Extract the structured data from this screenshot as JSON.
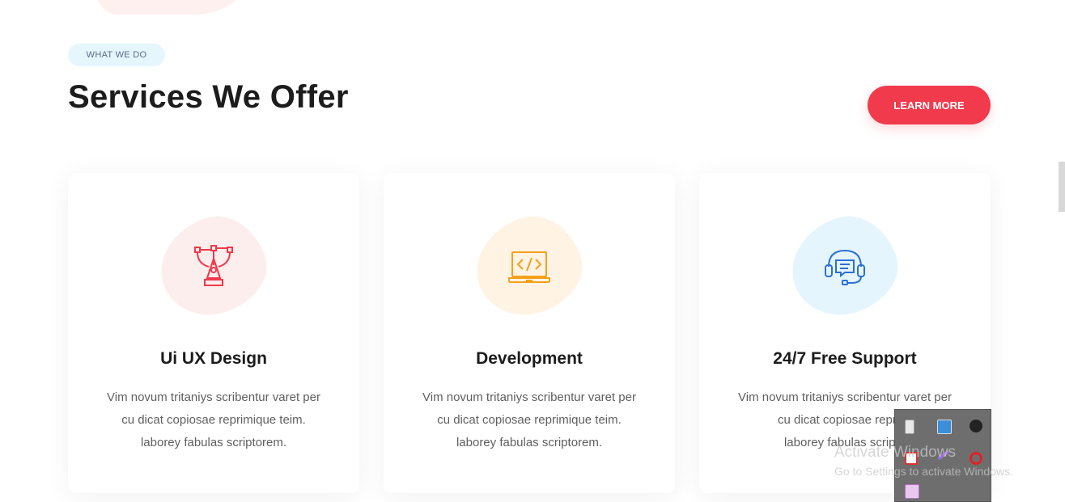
{
  "section": {
    "tag": "WHAT WE DO",
    "title": "Services We Offer",
    "learn_more_label": "LEARN MORE"
  },
  "services": [
    {
      "title": "Ui UX Design",
      "lines": [
        "Vim novum tritaniys scribentur varet per",
        "cu dicat copiosae reprimique teim.",
        "laborey fabulas scriptorem."
      ],
      "icon": "pen-tool-icon",
      "accent": "#f0394b",
      "blob": "#fdeeee"
    },
    {
      "title": "Development",
      "lines": [
        "Vim novum tritaniys scribentur varet per",
        "cu dicat copiosae reprimique teim.",
        "laborey fabulas scriptorem."
      ],
      "icon": "code-laptop-icon",
      "accent": "#f5a01a",
      "blob": "#fff3e4"
    },
    {
      "title": "24/7 Free Support",
      "lines": [
        "Vim novum tritaniys scribentur varet per",
        "cu dicat copiosae reprimi",
        "laborey fabulas scripto"
      ],
      "icon": "headset-chat-icon",
      "accent": "#2c6fd6",
      "blob": "#e5f5fd"
    }
  ],
  "system_tray": {
    "icons": [
      "usb-icon",
      "network-icon",
      "screen-capture-icon",
      "pdf-icon",
      "pen-icon",
      "opera-icon",
      "app-icon"
    ]
  },
  "watermark": {
    "line1": "Activate Windows",
    "line2": "Go to Settings to activate Windows."
  }
}
